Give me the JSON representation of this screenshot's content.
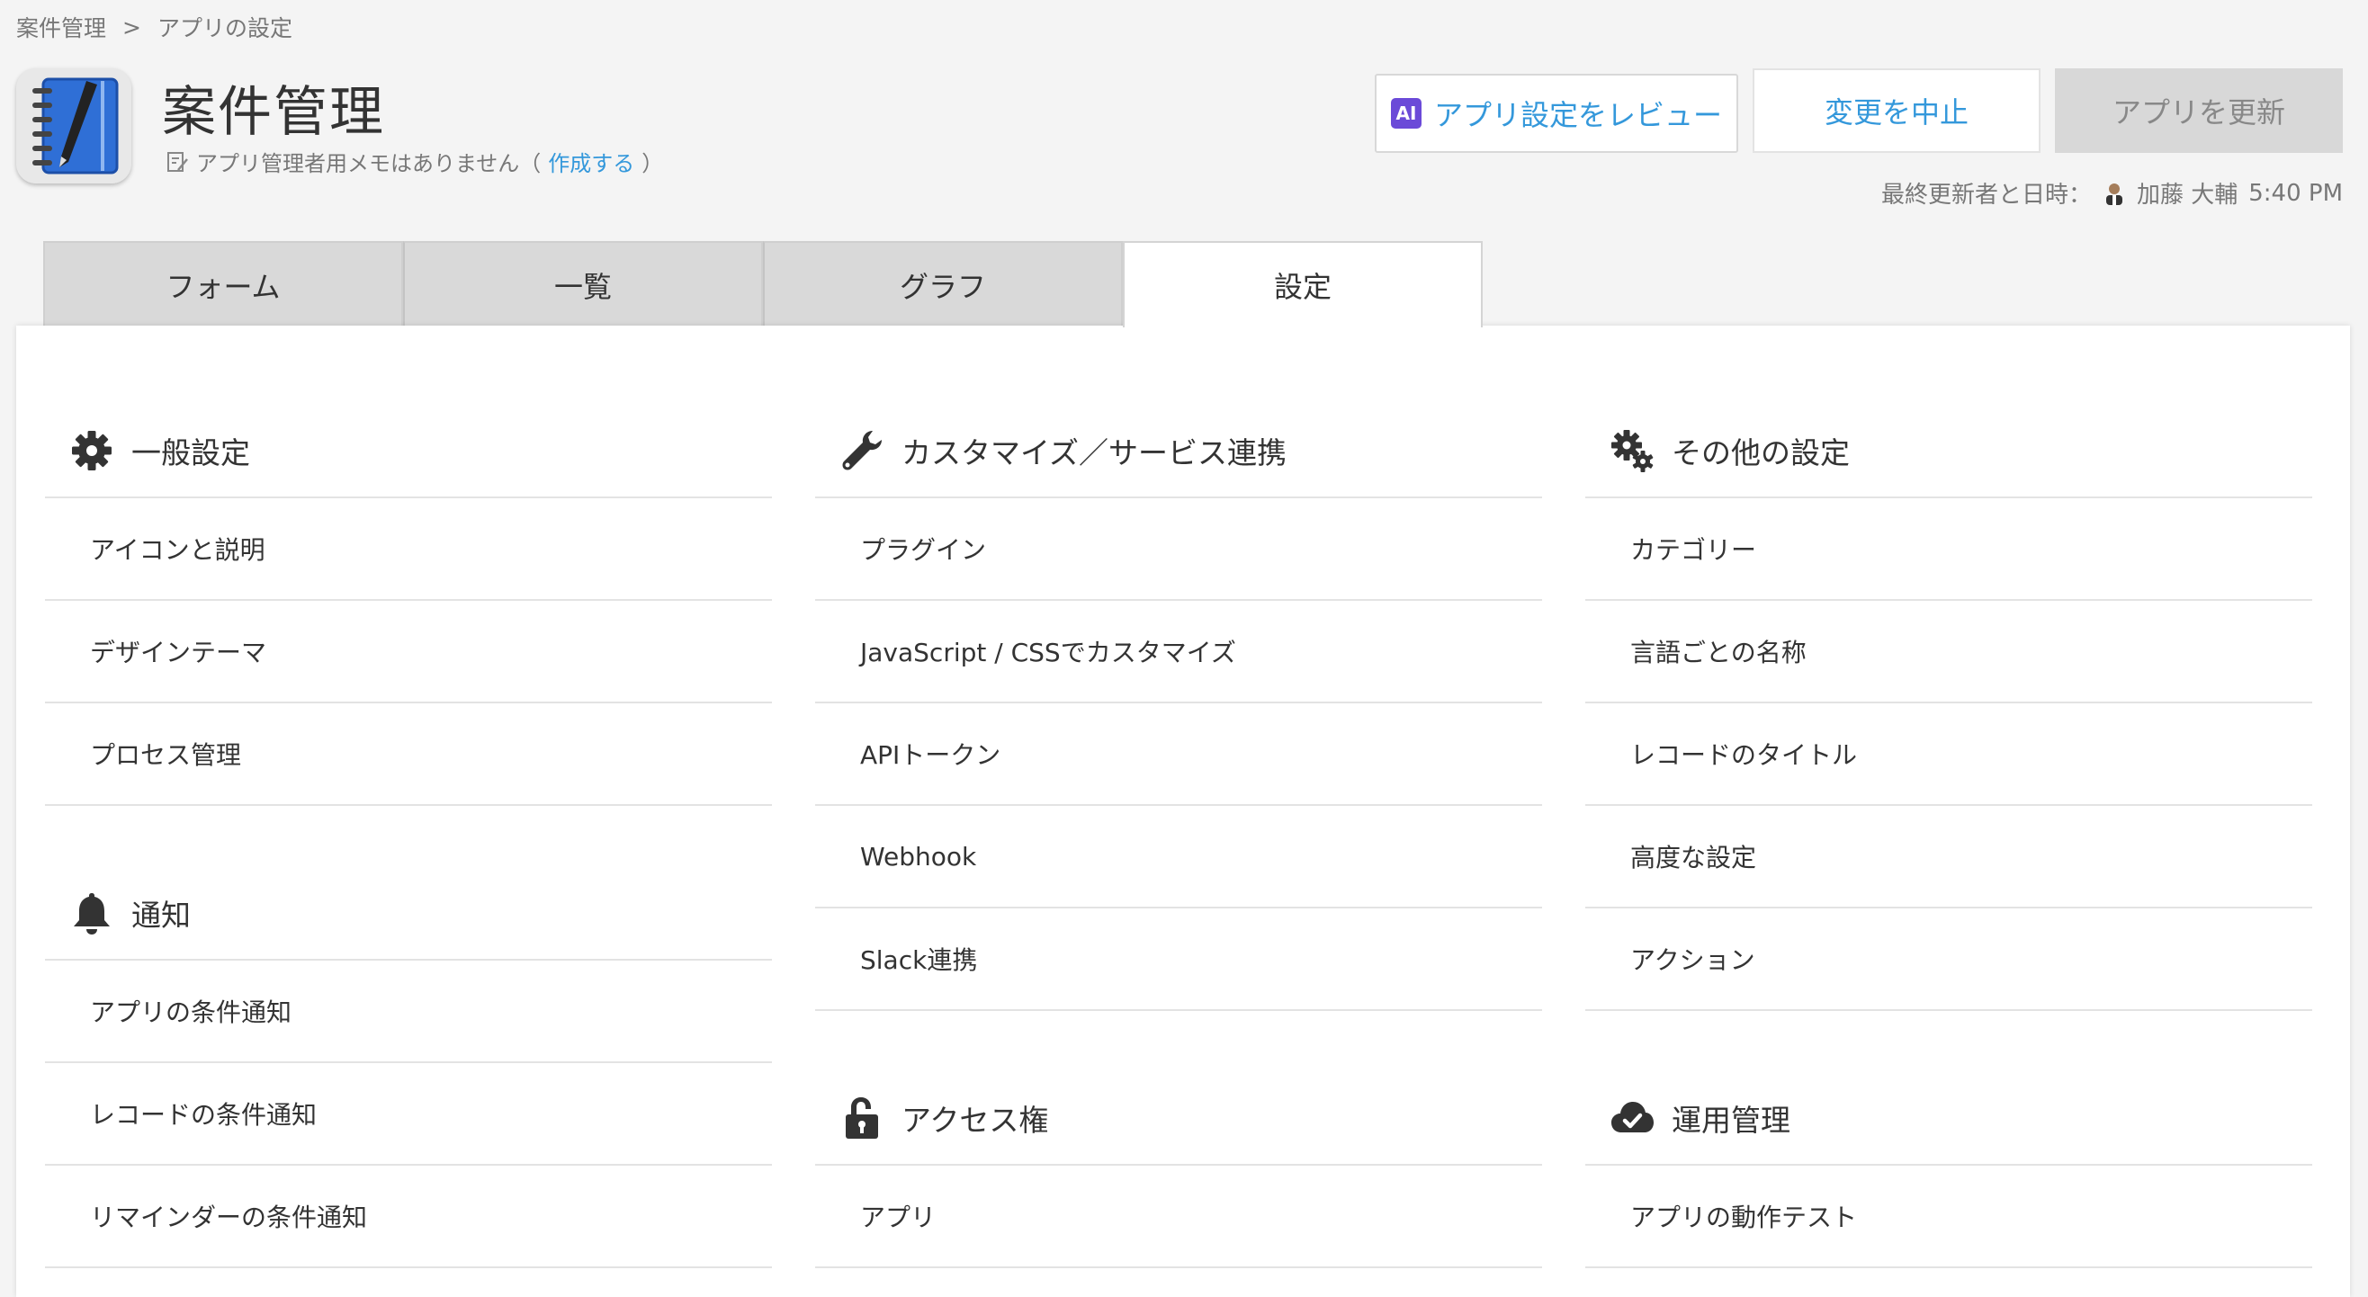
{
  "breadcrumb": {
    "items": [
      "案件管理",
      "アプリの設定"
    ],
    "separator": ">"
  },
  "app": {
    "title": "案件管理",
    "memo_text": "アプリ管理者用メモはありません（",
    "memo_link": "作成する",
    "memo_suffix": "）"
  },
  "header_buttons": {
    "review_badge": "AI",
    "review_label": "アプリ設定をレビュー",
    "cancel_label": "変更を中止",
    "update_label": "アプリを更新"
  },
  "last_updated": {
    "label": "最終更新者と日時：",
    "user": "加藤 大輔",
    "time": "5:40 PM"
  },
  "tabs": [
    {
      "label": "フォーム",
      "active": false
    },
    {
      "label": "一覧",
      "active": false
    },
    {
      "label": "グラフ",
      "active": false
    },
    {
      "label": "設定",
      "active": true
    }
  ],
  "columns": {
    "general": {
      "title": "一般設定",
      "items": [
        "アイコンと説明",
        "デザインテーマ",
        "プロセス管理"
      ]
    },
    "notification": {
      "title": "通知",
      "items": [
        "アプリの条件通知",
        "レコードの条件通知",
        "リマインダーの条件通知"
      ]
    },
    "customize": {
      "title": "カスタマイズ／サービス連携",
      "items": [
        "プラグイン",
        "JavaScript / CSSでカスタマイズ",
        "APIトークン",
        "Webhook",
        "Slack連携"
      ]
    },
    "access": {
      "title": "アクセス権",
      "items": [
        "アプリ"
      ]
    },
    "other": {
      "title": "その他の設定",
      "items": [
        "カテゴリー",
        "言語ごとの名称",
        "レコードのタイトル",
        "高度な設定",
        "アクション"
      ]
    },
    "operation": {
      "title": "運用管理",
      "items": [
        "アプリの動作テスト"
      ]
    }
  },
  "colors": {
    "link_blue": "#3498db",
    "ai_badge": "#6b4ad8",
    "app_icon_blue": "#2f6fd6"
  }
}
